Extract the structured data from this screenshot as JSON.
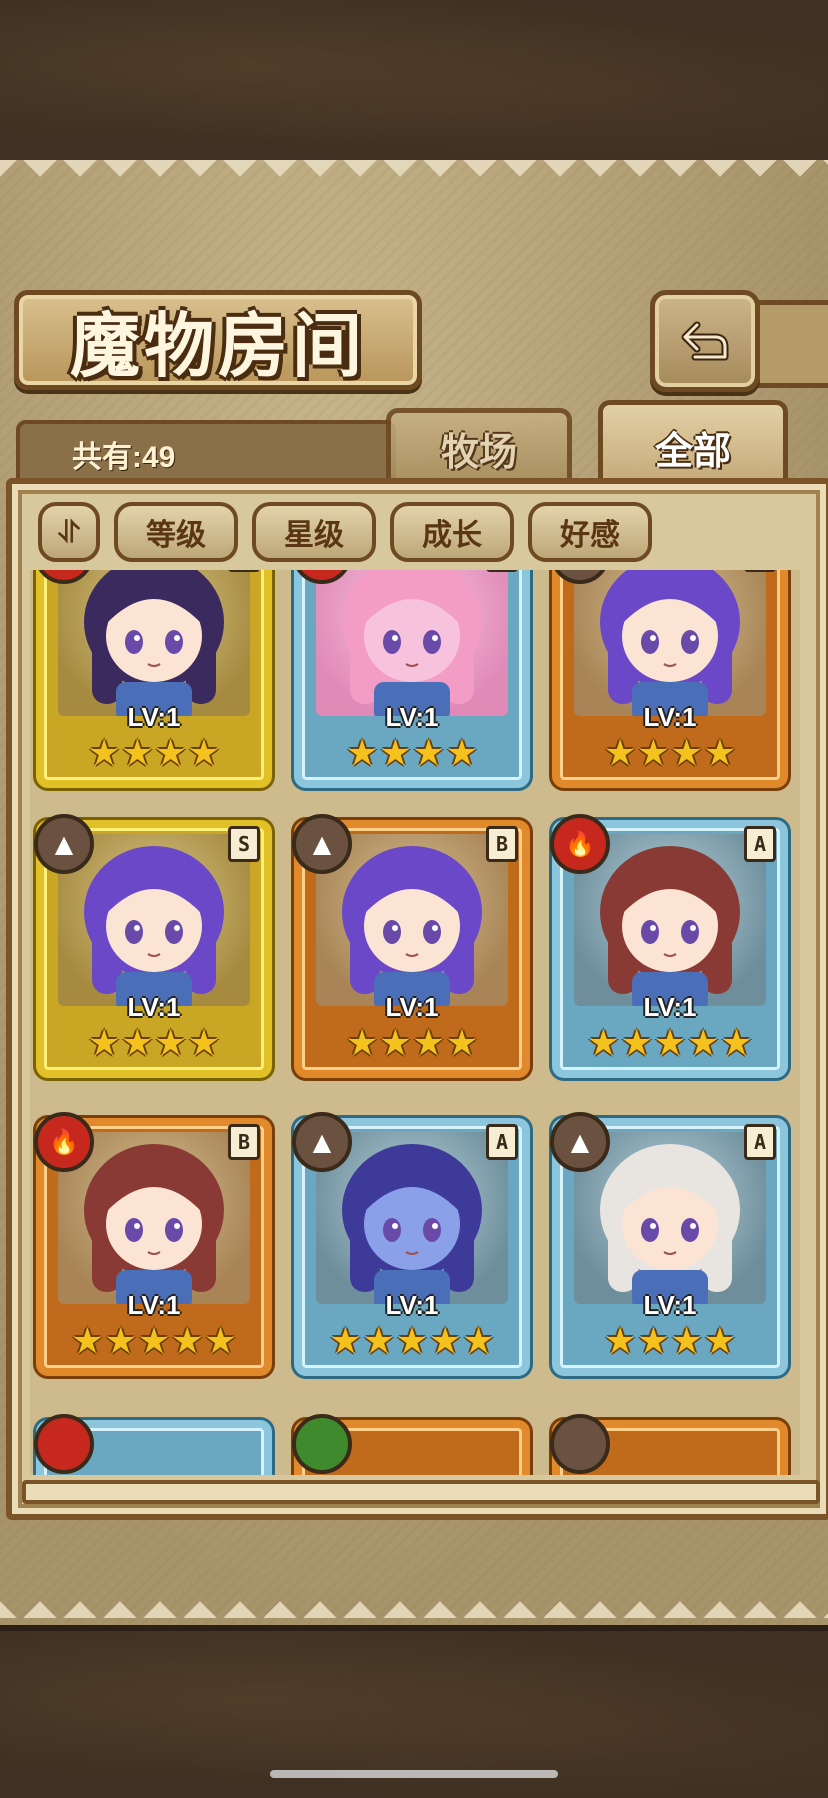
{
  "title": "魔物房间",
  "count": {
    "label": "共有:49"
  },
  "tabs": [
    {
      "label": "牧场",
      "active": false
    },
    {
      "label": "全部",
      "active": true
    }
  ],
  "filters": {
    "sort_icon": "⥯",
    "buttons": [
      "等级",
      "星级",
      "成长",
      "好感"
    ]
  },
  "monsters": [
    {
      "rank": "S",
      "element": "fire",
      "level": "LV:1",
      "stars": 4,
      "character": "fox-girl"
    },
    {
      "rank": "A",
      "element": "fire",
      "level": "LV:1",
      "stars": 4,
      "character": "pink-slime-girl"
    },
    {
      "rank": "B",
      "element": "earth",
      "level": "LV:1",
      "stars": 4,
      "character": "purple-hair-girl"
    },
    {
      "rank": "S",
      "element": "earth",
      "level": "LV:1",
      "stars": 4,
      "character": "purple-hair-girl"
    },
    {
      "rank": "B",
      "element": "earth",
      "level": "LV:1",
      "stars": 4,
      "character": "purple-hair-girl"
    },
    {
      "rank": "A",
      "element": "fire",
      "level": "LV:1",
      "stars": 5,
      "character": "eyepatch-girl"
    },
    {
      "rank": "B",
      "element": "fire",
      "level": "LV:1",
      "stars": 5,
      "character": "eyepatch-girl"
    },
    {
      "rank": "A",
      "element": "earth",
      "level": "LV:1",
      "stars": 5,
      "character": "blue-mermaid"
    },
    {
      "rank": "A",
      "element": "earth",
      "level": "LV:1",
      "stars": 4,
      "character": "straw-hat-girl"
    }
  ],
  "colors": {
    "S": "#e2c128",
    "A": "#8cc6dc",
    "B": "#e18a2c",
    "fire": "#c7281e",
    "earth": "#6b5240",
    "nature": "#3f8a2c",
    "star": "#f4c21c"
  },
  "icons": {
    "back": "back-arrow-icon",
    "fire": "fire-element-icon",
    "earth": "earth-element-icon"
  }
}
